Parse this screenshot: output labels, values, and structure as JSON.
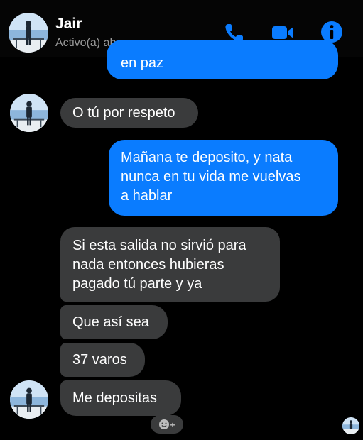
{
  "header": {
    "name": "Jair",
    "status": "Activo(a) ahora",
    "icons": [
      "phone-icon",
      "video-camera-icon",
      "info-icon"
    ],
    "accent": "#0a7cff"
  },
  "messages": {
    "partial_text": "en paz",
    "m1": "O tú por respeto",
    "m2_l1": "Mañana te deposito, y nata",
    "m2_l2": "nunca en tu vida me vuelvas",
    "m2_l3": "a hablar",
    "m3_l1": "Si esta salida no sirvió para",
    "m3_l2": "nada entonces hubieras",
    "m3_l3": "pagado tú parte y ya",
    "m4": "Que así sea",
    "m5": "37 varos",
    "m6": "Me depositas"
  },
  "reaction": {
    "icon": "smiley-icon",
    "plus": "+"
  },
  "colors": {
    "incoming": "#3a3b3c",
    "outgoing": "#0a7cff",
    "background": "#000000"
  }
}
